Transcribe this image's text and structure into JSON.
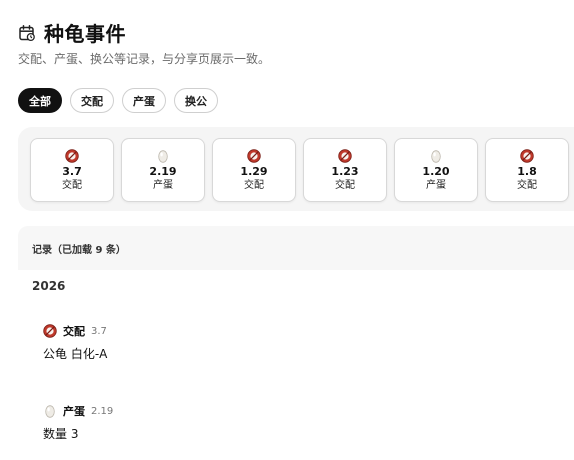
{
  "header": {
    "title": "种龟事件",
    "subtitle": "交配、产蛋、换公等记录，与分享页展示一致。"
  },
  "filters": [
    {
      "label": "全部",
      "active": true
    },
    {
      "label": "交配",
      "active": false
    },
    {
      "label": "产蛋",
      "active": false
    },
    {
      "label": "换公",
      "active": false
    }
  ],
  "timeline": [
    {
      "date": "3.7",
      "type": "交配",
      "icon": "mating-icon"
    },
    {
      "date": "2.19",
      "type": "产蛋",
      "icon": "egg-icon"
    },
    {
      "date": "1.29",
      "type": "交配",
      "icon": "mating-icon"
    },
    {
      "date": "1.23",
      "type": "交配",
      "icon": "mating-icon"
    },
    {
      "date": "1.20",
      "type": "产蛋",
      "icon": "egg-icon"
    },
    {
      "date": "1.8",
      "type": "交配",
      "icon": "mating-icon"
    }
  ],
  "records": {
    "heading": "记录（已加载 9 条）",
    "year": "2026",
    "items": [
      {
        "type": "交配",
        "date": "3.7",
        "detail": "公龟 白化-A",
        "icon": "mating-icon"
      },
      {
        "type": "产蛋",
        "date": "2.19",
        "detail": "数量 3",
        "icon": "egg-icon"
      }
    ]
  },
  "colors": {
    "accent": "#111111",
    "mating_icon": "#c0392b",
    "egg_icon": "#e9e6de"
  }
}
